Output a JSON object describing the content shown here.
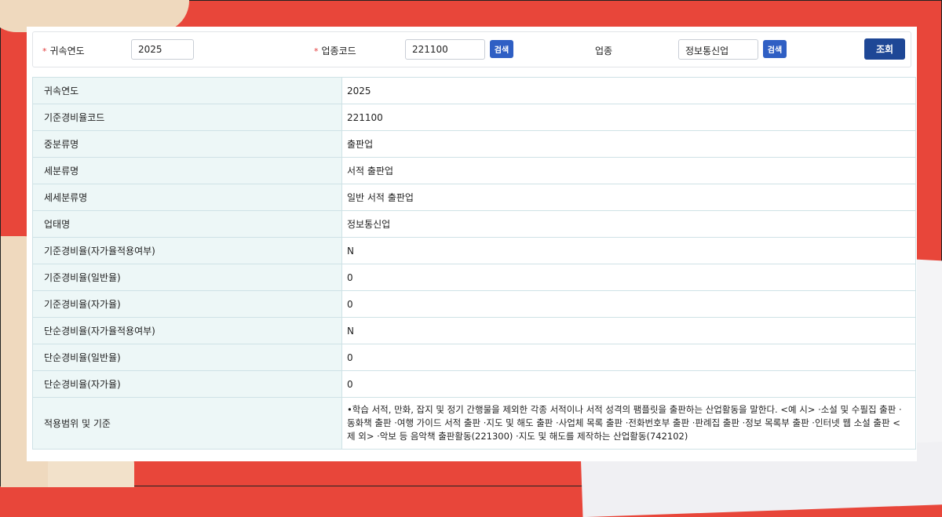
{
  "search": {
    "year_label": "귀속연도",
    "year_value": "2025",
    "code_label": "업종코드",
    "code_value": "221100",
    "code_search_button": "검색",
    "industry_label": "업종",
    "industry_value": "정보통신업",
    "industry_search_button": "검색",
    "query_button": "조회"
  },
  "colors": {
    "required": "#e23b3b",
    "search_button": "#2f5fc4",
    "query_button": "#1e4796",
    "header_cell": "#edf7f7"
  },
  "table": {
    "rows": [
      {
        "label": "귀속연도",
        "value": "2025"
      },
      {
        "label": "기준경비율코드",
        "value": "221100"
      },
      {
        "label": "중분류명",
        "value": "출판업"
      },
      {
        "label": "세분류명",
        "value": "서적 출판업"
      },
      {
        "label": "세세분류명",
        "value": "일반 서적 출판업"
      },
      {
        "label": "업태명",
        "value": "정보통신업"
      },
      {
        "label": "기준경비율(자가율적용여부)",
        "value": "N"
      },
      {
        "label": "기준경비율(일반율)",
        "value": "0"
      },
      {
        "label": "기준경비율(자가율)",
        "value": "0"
      },
      {
        "label": "단순경비율(자가율적용여부)",
        "value": "N"
      },
      {
        "label": "단순경비율(일반율)",
        "value": "0"
      },
      {
        "label": "단순경비율(자가율)",
        "value": "0"
      },
      {
        "label": "적용범위 및 기준",
        "value": "•학습 서적, 만화, 잡지 및 정기 간행물을 제외한 각종 서적이나 서적 성격의 팸플릿을 출판하는 산업활동을 말한다. <예 시> ·소설 및 수필집 출판 ·동화책 출판 ·여행 가이드 서적 출판 ·지도 및 해도 출판 ·사업체 목록 출판 ·전화번호부 출판 ·판례집 출판 ·정보 목록부 출판 ·인터넷 웹 소설 출판 <제 외> ·악보 등 음악책 출판활동(221300) ·지도 및 해도를 제작하는 산업활동(742102)"
      }
    ]
  }
}
